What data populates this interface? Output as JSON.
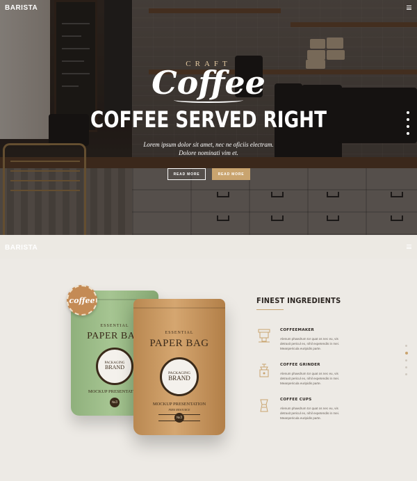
{
  "brand": "BARISTA",
  "hero": {
    "logo_top": "CRAFT",
    "logo_script": "Coffee",
    "title": "COFFEE SERVED RIGHT",
    "subtitle_line1": "Lorem ipsum dolor sit amet, nec ne oficiis electram.",
    "subtitle_line2": "Dolore nominati vim et.",
    "button_read_more_outline": "READ MORE",
    "button_read_more_filled": "READ MORE",
    "pagination_count": 4
  },
  "section2": {
    "brand": "BARISTA",
    "heading": "FINEST INGREDIENTS",
    "accent_color": "#c9a46f",
    "product": {
      "badge": "coffee",
      "essential": "ESSENTIAL",
      "paper_bag": "PAPER BAG",
      "packaging": "PACKAGING",
      "brand_word": "BRAND",
      "mockup": "MOCKUP PRESENTATION",
      "free": "FREE RESOURCE",
      "number": "№3"
    },
    "features": [
      {
        "icon": "coffeemaker-icon",
        "title": "COFFEEMAKER",
        "text": "Alenum phaedrum tor quat os nec eu, vis detraxit pericul ex, nihil expetendis in mei. Meanpericula euripidis parte."
      },
      {
        "icon": "coffee-grinder-icon",
        "title": "COFFEE GRINDER",
        "text": "Alenum phaedrum tor quat os nec eu, vis detraxit pericul ex, nihil expetendis in mei. Meanpericula euripidis parte."
      },
      {
        "icon": "coffee-cups-icon",
        "title": "COFFEE CUPS",
        "text": "Alenum phaedrum tor quat os nec eu, vis detraxit pericul ex, nihil expetendis in mei. Meanpericula euripidis parte."
      }
    ]
  }
}
